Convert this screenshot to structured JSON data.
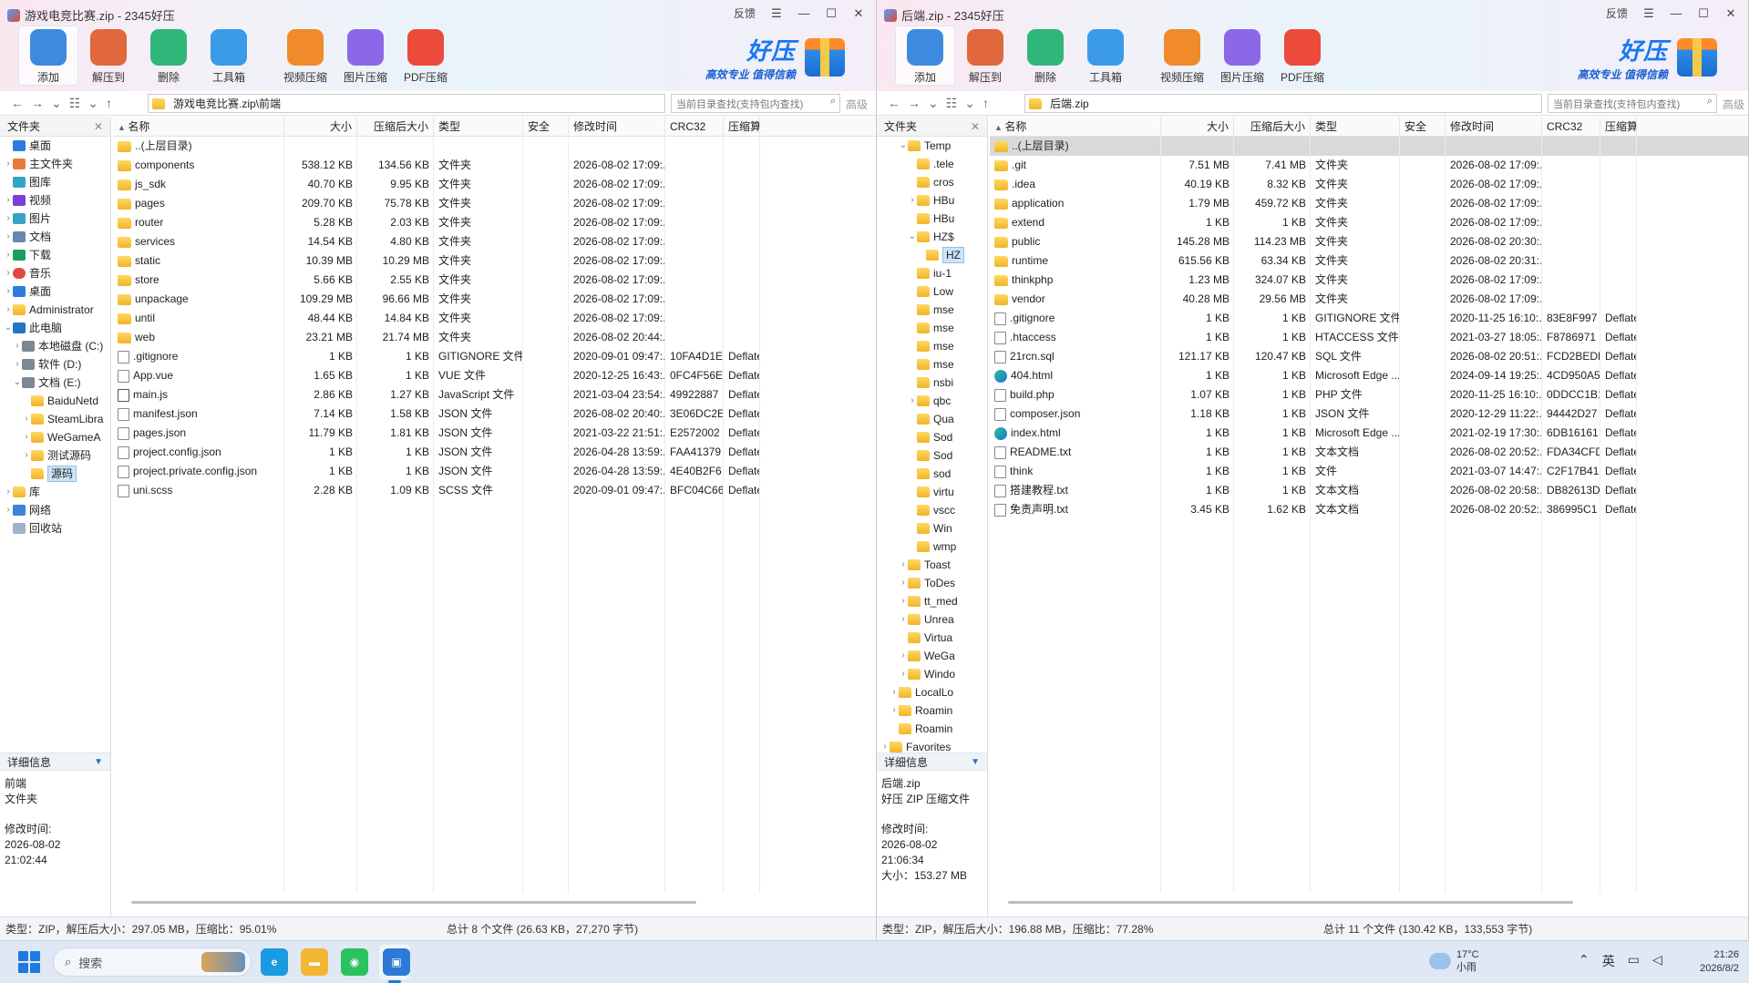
{
  "left": {
    "title": "游戏电竞比赛.zip - 2345好压",
    "window_controls": {
      "feedback": "反馈",
      "menu": "☰",
      "minimize": "—",
      "maximize": "☐",
      "close": "✕"
    },
    "toolbar": [
      {
        "label": "添加",
        "icon": "add-icon",
        "color": "#3d8be0"
      },
      {
        "label": "解压到",
        "icon": "extract-icon",
        "color": "#e0683c"
      },
      {
        "label": "删除",
        "icon": "recycle-icon",
        "color": "#2fb77a"
      },
      {
        "label": "工具箱",
        "icon": "toolbox-icon",
        "color": "#3b9be8"
      },
      {
        "label": "视频压缩",
        "icon": "video-compress-icon",
        "color": "#f08a2a"
      },
      {
        "label": "图片压缩",
        "icon": "image-compress-icon",
        "color": "#8a68e8"
      },
      {
        "label": "PDF压缩",
        "icon": "pdf-compress-icon",
        "color": "#ec4a3a"
      }
    ],
    "brand": {
      "name": "好压",
      "slogan": "高效专业 值得信赖"
    },
    "path": "游戏电竞比赛.zip\\前端",
    "search_placeholder": "当前目录查找(支持包内查找)",
    "advanced": "高级",
    "tree_header": "文件夹",
    "tree": [
      {
        "label": "桌面",
        "icon": "blue",
        "indent": 0,
        "arrow": ""
      },
      {
        "label": "主文件夹",
        "icon": "home",
        "indent": 0,
        "arrow": "›"
      },
      {
        "label": "图库",
        "icon": "img",
        "indent": 0,
        "arrow": ""
      },
      {
        "label": "视频",
        "icon": "vid",
        "indent": 0,
        "arrow": "›"
      },
      {
        "label": "图片",
        "icon": "img",
        "indent": 0,
        "arrow": "›"
      },
      {
        "label": "文档",
        "icon": "doc",
        "indent": 0,
        "arrow": "›"
      },
      {
        "label": "下载",
        "icon": "dl",
        "indent": 0,
        "arrow": "›"
      },
      {
        "label": "音乐",
        "icon": "mus",
        "indent": 0,
        "arrow": "›"
      },
      {
        "label": "桌面",
        "icon": "blue",
        "indent": 0,
        "arrow": "›"
      },
      {
        "label": "Administrator",
        "icon": "folder",
        "indent": 0,
        "arrow": "›"
      },
      {
        "label": "此电脑",
        "icon": "pc",
        "indent": 0,
        "arrow": "⌄"
      },
      {
        "label": "本地磁盘 (C:)",
        "icon": "drv",
        "indent": 1,
        "arrow": "›"
      },
      {
        "label": "软件 (D:)",
        "icon": "drv",
        "indent": 1,
        "arrow": "›"
      },
      {
        "label": "文档 (E:)",
        "icon": "drv",
        "indent": 1,
        "arrow": "⌄"
      },
      {
        "label": "BaiduNetd",
        "icon": "folder",
        "indent": 2,
        "arrow": ""
      },
      {
        "label": "SteamLibra",
        "icon": "folder",
        "indent": 2,
        "arrow": "›"
      },
      {
        "label": "WeGameA",
        "icon": "folder",
        "indent": 2,
        "arrow": "›"
      },
      {
        "label": "测试源码",
        "icon": "folder",
        "indent": 2,
        "arrow": "›"
      },
      {
        "label": "源码",
        "icon": "folder",
        "indent": 2,
        "arrow": "",
        "selected": true
      },
      {
        "label": "库",
        "icon": "folder",
        "indent": 0,
        "arrow": "›"
      },
      {
        "label": "网络",
        "icon": "net",
        "indent": 0,
        "arrow": "›"
      },
      {
        "label": "回收站",
        "icon": "bin",
        "indent": 0,
        "arrow": ""
      }
    ],
    "details": {
      "header": "详细信息",
      "name": "前端",
      "type": "文件夹",
      "mtime_label": "修改时间:",
      "mtime_date": "2026-08-02",
      "mtime_time": "21:02:44",
      "size": ""
    },
    "columns": [
      "名称",
      "大小",
      "压缩后大小",
      "类型",
      "安全",
      "修改时间",
      "CRC32",
      "压缩算"
    ],
    "files": [
      {
        "name": "..(上层目录)",
        "icon": "folder",
        "size": "",
        "packed": "",
        "type": "",
        "mtime": "",
        "crc": "",
        "method": ""
      },
      {
        "name": "components",
        "icon": "folder",
        "size": "538.12 KB",
        "packed": "134.56 KB",
        "type": "文件夹",
        "mtime": "2026-08-02 17:09:...",
        "crc": "",
        "method": ""
      },
      {
        "name": "js_sdk",
        "icon": "folder",
        "size": "40.70 KB",
        "packed": "9.95 KB",
        "type": "文件夹",
        "mtime": "2026-08-02 17:09:...",
        "crc": "",
        "method": ""
      },
      {
        "name": "pages",
        "icon": "folder",
        "size": "209.70 KB",
        "packed": "75.78 KB",
        "type": "文件夹",
        "mtime": "2026-08-02 17:09:...",
        "crc": "",
        "method": ""
      },
      {
        "name": "router",
        "icon": "folder",
        "size": "5.28 KB",
        "packed": "2.03 KB",
        "type": "文件夹",
        "mtime": "2026-08-02 17:09:...",
        "crc": "",
        "method": ""
      },
      {
        "name": "services",
        "icon": "folder",
        "size": "14.54 KB",
        "packed": "4.80 KB",
        "type": "文件夹",
        "mtime": "2026-08-02 17:09:...",
        "crc": "",
        "method": ""
      },
      {
        "name": "static",
        "icon": "folder",
        "size": "10.39 MB",
        "packed": "10.29 MB",
        "type": "文件夹",
        "mtime": "2026-08-02 17:09:...",
        "crc": "",
        "method": ""
      },
      {
        "name": "store",
        "icon": "folder",
        "size": "5.66 KB",
        "packed": "2.55 KB",
        "type": "文件夹",
        "mtime": "2026-08-02 17:09:...",
        "crc": "",
        "method": ""
      },
      {
        "name": "unpackage",
        "icon": "folder",
        "size": "109.29 MB",
        "packed": "96.66 MB",
        "type": "文件夹",
        "mtime": "2026-08-02 17:09:...",
        "crc": "",
        "method": ""
      },
      {
        "name": "until",
        "icon": "folder",
        "size": "48.44 KB",
        "packed": "14.84 KB",
        "type": "文件夹",
        "mtime": "2026-08-02 17:09:...",
        "crc": "",
        "method": ""
      },
      {
        "name": "web",
        "icon": "folder",
        "size": "23.21 MB",
        "packed": "21.74 MB",
        "type": "文件夹",
        "mtime": "2026-08-02 20:44:...",
        "crc": "",
        "method": ""
      },
      {
        "name": ".gitignore",
        "icon": "file",
        "size": "1 KB",
        "packed": "1 KB",
        "type": "GITIGNORE 文件",
        "mtime": "2020-09-01 09:47:...",
        "crc": "10FA4D1E",
        "method": "Deflate"
      },
      {
        "name": "App.vue",
        "icon": "file",
        "size": "1.65 KB",
        "packed": "1 KB",
        "type": "VUE 文件",
        "mtime": "2020-12-25 16:43:...",
        "crc": "0FC4F56E",
        "method": "Deflate"
      },
      {
        "name": "main.js",
        "icon": "js",
        "size": "2.86 KB",
        "packed": "1.27 KB",
        "type": "JavaScript 文件",
        "mtime": "2021-03-04 23:54:...",
        "crc": "49922887",
        "method": "Deflate"
      },
      {
        "name": "manifest.json",
        "icon": "file",
        "size": "7.14 KB",
        "packed": "1.58 KB",
        "type": "JSON 文件",
        "mtime": "2026-08-02 20:40:...",
        "crc": "3E06DC2E",
        "method": "Deflate"
      },
      {
        "name": "pages.json",
        "icon": "file",
        "size": "11.79 KB",
        "packed": "1.81 KB",
        "type": "JSON 文件",
        "mtime": "2021-03-22 21:51:...",
        "crc": "E2572002",
        "method": "Deflate"
      },
      {
        "name": "project.config.json",
        "icon": "file",
        "size": "1 KB",
        "packed": "1 KB",
        "type": "JSON 文件",
        "mtime": "2026-04-28 13:59:...",
        "crc": "FAA41379",
        "method": "Deflate"
      },
      {
        "name": "project.private.config.json",
        "icon": "file",
        "size": "1 KB",
        "packed": "1 KB",
        "type": "JSON 文件",
        "mtime": "2026-04-28 13:59:...",
        "crc": "4E40B2F6",
        "method": "Deflate"
      },
      {
        "name": "uni.scss",
        "icon": "file",
        "size": "2.28 KB",
        "packed": "1.09 KB",
        "type": "SCSS 文件",
        "mtime": "2020-09-01 09:47:...",
        "crc": "BFC04C66",
        "method": "Deflate"
      }
    ],
    "status_left": "类型：ZIP，解压后大小：297.05 MB，压缩比：95.01%",
    "status_right": "总计 8 个文件 (26.63 KB，27,270 字节)"
  },
  "right": {
    "title": "后端.zip - 2345好压",
    "window_controls": {
      "feedback": "反馈",
      "menu": "☰",
      "minimize": "—",
      "maximize": "☐",
      "close": "✕"
    },
    "toolbar": [
      {
        "label": "添加",
        "icon": "add-icon",
        "color": "#3d8be0"
      },
      {
        "label": "解压到",
        "icon": "extract-icon",
        "color": "#e0683c"
      },
      {
        "label": "删除",
        "icon": "recycle-icon",
        "color": "#2fb77a"
      },
      {
        "label": "工具箱",
        "icon": "toolbox-icon",
        "color": "#3b9be8"
      },
      {
        "label": "视频压缩",
        "icon": "video-compress-icon",
        "color": "#f08a2a"
      },
      {
        "label": "图片压缩",
        "icon": "image-compress-icon",
        "color": "#8a68e8"
      },
      {
        "label": "PDF压缩",
        "icon": "pdf-compress-icon",
        "color": "#ec4a3a"
      }
    ],
    "brand": {
      "name": "好压",
      "slogan": "高效专业 值得信赖"
    },
    "path": "后端.zip",
    "search_placeholder": "当前目录查找(支持包内查找)",
    "advanced": "高级",
    "tree_header": "文件夹",
    "tree": [
      {
        "label": "Temp",
        "icon": "folder",
        "indent": 2,
        "arrow": "⌄"
      },
      {
        "label": ".tele",
        "icon": "folder",
        "indent": 3,
        "arrow": ""
      },
      {
        "label": "cros",
        "icon": "folder",
        "indent": 3,
        "arrow": ""
      },
      {
        "label": "HBu",
        "icon": "folder",
        "indent": 3,
        "arrow": "›"
      },
      {
        "label": "HBu",
        "icon": "folder",
        "indent": 3,
        "arrow": ""
      },
      {
        "label": "HZ$",
        "icon": "folder",
        "indent": 3,
        "arrow": "⌄"
      },
      {
        "label": "HZ",
        "icon": "folder",
        "indent": 4,
        "arrow": "",
        "selected": true
      },
      {
        "label": "iu-1",
        "icon": "folder",
        "indent": 3,
        "arrow": ""
      },
      {
        "label": "Low",
        "icon": "folder",
        "indent": 3,
        "arrow": ""
      },
      {
        "label": "mse",
        "icon": "folder",
        "indent": 3,
        "arrow": ""
      },
      {
        "label": "mse",
        "icon": "folder",
        "indent": 3,
        "arrow": ""
      },
      {
        "label": "mse",
        "icon": "folder",
        "indent": 3,
        "arrow": ""
      },
      {
        "label": "mse",
        "icon": "folder",
        "indent": 3,
        "arrow": ""
      },
      {
        "label": "nsbi",
        "icon": "folder",
        "indent": 3,
        "arrow": ""
      },
      {
        "label": "qbc",
        "icon": "folder",
        "indent": 3,
        "arrow": "›"
      },
      {
        "label": "Qua",
        "icon": "folder",
        "indent": 3,
        "arrow": ""
      },
      {
        "label": "Sod",
        "icon": "folder",
        "indent": 3,
        "arrow": ""
      },
      {
        "label": "Sod",
        "icon": "folder",
        "indent": 3,
        "arrow": ""
      },
      {
        "label": "sod",
        "icon": "folder",
        "indent": 3,
        "arrow": ""
      },
      {
        "label": "virtu",
        "icon": "folder",
        "indent": 3,
        "arrow": ""
      },
      {
        "label": "vscc",
        "icon": "folder",
        "indent": 3,
        "arrow": ""
      },
      {
        "label": "Win",
        "icon": "folder",
        "indent": 3,
        "arrow": ""
      },
      {
        "label": "wmp",
        "icon": "folder",
        "indent": 3,
        "arrow": ""
      },
      {
        "label": "Toast",
        "icon": "folder",
        "indent": 2,
        "arrow": "›"
      },
      {
        "label": "ToDes",
        "icon": "folder",
        "indent": 2,
        "arrow": "›"
      },
      {
        "label": "tt_med",
        "icon": "folder",
        "indent": 2,
        "arrow": "›"
      },
      {
        "label": "Unrea",
        "icon": "folder",
        "indent": 2,
        "arrow": "›"
      },
      {
        "label": "Virtua",
        "icon": "folder",
        "indent": 2,
        "arrow": ""
      },
      {
        "label": "WeGa",
        "icon": "folder",
        "indent": 2,
        "arrow": "›"
      },
      {
        "label": "Windo",
        "icon": "folder",
        "indent": 2,
        "arrow": "›"
      },
      {
        "label": "LocalLo",
        "icon": "folder",
        "indent": 1,
        "arrow": "›"
      },
      {
        "label": "Roamin",
        "icon": "folder",
        "indent": 1,
        "arrow": "›"
      },
      {
        "label": "Roamin",
        "icon": "folder",
        "indent": 1,
        "arrow": ""
      },
      {
        "label": "Favorites",
        "icon": "folder",
        "indent": 0,
        "arrow": "›"
      }
    ],
    "details": {
      "header": "详细信息",
      "name": "后端.zip",
      "type": "好压 ZIP 压缩文件",
      "mtime_label": "修改时间:",
      "mtime_date": "2026-08-02",
      "mtime_time": "21:06:34",
      "size": "大小：153.27 MB"
    },
    "columns": [
      "名称",
      "大小",
      "压缩后大小",
      "类型",
      "安全",
      "修改时间",
      "CRC32",
      "压缩算"
    ],
    "files": [
      {
        "name": "..(上层目录)",
        "icon": "folder",
        "size": "",
        "packed": "",
        "type": "",
        "mtime": "",
        "crc": "",
        "method": "",
        "selected": true
      },
      {
        "name": ".git",
        "icon": "folder",
        "size": "7.51 MB",
        "packed": "7.41 MB",
        "type": "文件夹",
        "mtime": "2026-08-02 17:09:...",
        "crc": "",
        "method": ""
      },
      {
        "name": ".idea",
        "icon": "folder",
        "size": "40.19 KB",
        "packed": "8.32 KB",
        "type": "文件夹",
        "mtime": "2026-08-02 17:09:...",
        "crc": "",
        "method": ""
      },
      {
        "name": "application",
        "icon": "folder",
        "size": "1.79 MB",
        "packed": "459.72 KB",
        "type": "文件夹",
        "mtime": "2026-08-02 17:09:...",
        "crc": "",
        "method": ""
      },
      {
        "name": "extend",
        "icon": "folder",
        "size": "1 KB",
        "packed": "1 KB",
        "type": "文件夹",
        "mtime": "2026-08-02 17:09:...",
        "crc": "",
        "method": ""
      },
      {
        "name": "public",
        "icon": "folder",
        "size": "145.28 MB",
        "packed": "114.23 MB",
        "type": "文件夹",
        "mtime": "2026-08-02 20:30:...",
        "crc": "",
        "method": ""
      },
      {
        "name": "runtime",
        "icon": "folder",
        "size": "615.56 KB",
        "packed": "63.34 KB",
        "type": "文件夹",
        "mtime": "2026-08-02 20:31:...",
        "crc": "",
        "method": ""
      },
      {
        "name": "thinkphp",
        "icon": "folder",
        "size": "1.23 MB",
        "packed": "324.07 KB",
        "type": "文件夹",
        "mtime": "2026-08-02 17:09:...",
        "crc": "",
        "method": ""
      },
      {
        "name": "vendor",
        "icon": "folder",
        "size": "40.28 MB",
        "packed": "29.56 MB",
        "type": "文件夹",
        "mtime": "2026-08-02 17:09:...",
        "crc": "",
        "method": ""
      },
      {
        "name": ".gitignore",
        "icon": "file",
        "size": "1 KB",
        "packed": "1 KB",
        "type": "GITIGNORE 文件",
        "mtime": "2020-11-25 16:10:...",
        "crc": "83E8F997",
        "method": "Deflate"
      },
      {
        "name": ".htaccess",
        "icon": "file",
        "size": "1 KB",
        "packed": "1 KB",
        "type": "HTACCESS 文件",
        "mtime": "2021-03-27 18:05:...",
        "crc": "F8786971",
        "method": "Deflate"
      },
      {
        "name": "21rcn.sql",
        "icon": "file",
        "size": "121.17 KB",
        "packed": "120.47 KB",
        "type": "SQL 文件",
        "mtime": "2026-08-02 20:51:...",
        "crc": "FCD2BEDF",
        "method": "Deflate"
      },
      {
        "name": "404.html",
        "icon": "edge",
        "size": "1 KB",
        "packed": "1 KB",
        "type": "Microsoft Edge ...",
        "mtime": "2024-09-14 19:25:...",
        "crc": "4CD950A5",
        "method": "Deflate"
      },
      {
        "name": "build.php",
        "icon": "file",
        "size": "1.07 KB",
        "packed": "1 KB",
        "type": "PHP 文件",
        "mtime": "2020-11-25 16:10:...",
        "crc": "0DDCC1B1",
        "method": "Deflate"
      },
      {
        "name": "composer.json",
        "icon": "file",
        "size": "1.18 KB",
        "packed": "1 KB",
        "type": "JSON 文件",
        "mtime": "2020-12-29 11:22:...",
        "crc": "94442D27",
        "method": "Deflate"
      },
      {
        "name": "index.html",
        "icon": "edge",
        "size": "1 KB",
        "packed": "1 KB",
        "type": "Microsoft Edge ...",
        "mtime": "2021-02-19 17:30:...",
        "crc": "6DB16161",
        "method": "Deflate"
      },
      {
        "name": "README.txt",
        "icon": "file",
        "size": "1 KB",
        "packed": "1 KB",
        "type": "文本文档",
        "mtime": "2026-08-02 20:52:...",
        "crc": "FDA34CFD",
        "method": "Deflate"
      },
      {
        "name": "think",
        "icon": "file",
        "size": "1 KB",
        "packed": "1 KB",
        "type": "文件",
        "mtime": "2021-03-07 14:47:...",
        "crc": "C2F17B41",
        "method": "Deflate"
      },
      {
        "name": "搭建教程.txt",
        "icon": "file",
        "size": "1 KB",
        "packed": "1 KB",
        "type": "文本文档",
        "mtime": "2026-08-02 20:58:...",
        "crc": "DB82613D",
        "method": "Deflate"
      },
      {
        "name": "免责声明.txt",
        "icon": "file",
        "size": "3.45 KB",
        "packed": "1.62 KB",
        "type": "文本文档",
        "mtime": "2026-08-02 20:52:...",
        "crc": "386995C1",
        "method": "Deflate"
      }
    ],
    "status_left": "类型：ZIP，解压后大小：196.88 MB，压缩比：77.28%",
    "status_right": "总计 11 个文件 (130.42 KB，133,553 字节)"
  },
  "taskbar": {
    "search_label": "搜索",
    "weather_temp": "17°C",
    "weather_desc": "小雨",
    "ime": "英",
    "time": "21:26",
    "date": "2026/8/2",
    "apps": [
      {
        "name": "edge-icon",
        "color": "#1a9ae0",
        "glyph": "e"
      },
      {
        "name": "file-explorer-icon",
        "color": "#f2b632",
        "glyph": "▬"
      },
      {
        "name": "wechat-icon",
        "color": "#2ac25e",
        "glyph": "◉"
      },
      {
        "name": "haozip-icon",
        "color": "#2d7ad6",
        "glyph": "▣"
      }
    ]
  }
}
